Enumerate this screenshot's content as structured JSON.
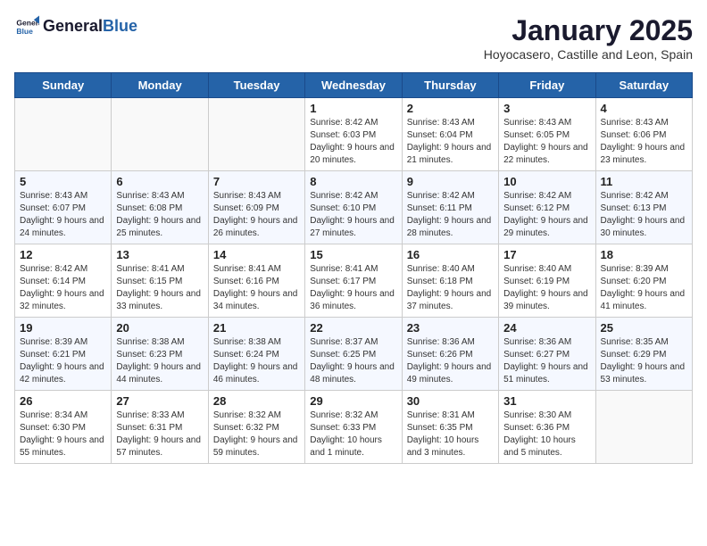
{
  "logo": {
    "line1": "General",
    "line2": "Blue"
  },
  "title": "January 2025",
  "subtitle": "Hoyocasero, Castille and Leon, Spain",
  "days_of_week": [
    "Sunday",
    "Monday",
    "Tuesday",
    "Wednesday",
    "Thursday",
    "Friday",
    "Saturday"
  ],
  "weeks": [
    [
      {
        "day": "",
        "info": ""
      },
      {
        "day": "",
        "info": ""
      },
      {
        "day": "",
        "info": ""
      },
      {
        "day": "1",
        "info": "Sunrise: 8:42 AM\nSunset: 6:03 PM\nDaylight: 9 hours and 20 minutes."
      },
      {
        "day": "2",
        "info": "Sunrise: 8:43 AM\nSunset: 6:04 PM\nDaylight: 9 hours and 21 minutes."
      },
      {
        "day": "3",
        "info": "Sunrise: 8:43 AM\nSunset: 6:05 PM\nDaylight: 9 hours and 22 minutes."
      },
      {
        "day": "4",
        "info": "Sunrise: 8:43 AM\nSunset: 6:06 PM\nDaylight: 9 hours and 23 minutes."
      }
    ],
    [
      {
        "day": "5",
        "info": "Sunrise: 8:43 AM\nSunset: 6:07 PM\nDaylight: 9 hours and 24 minutes."
      },
      {
        "day": "6",
        "info": "Sunrise: 8:43 AM\nSunset: 6:08 PM\nDaylight: 9 hours and 25 minutes."
      },
      {
        "day": "7",
        "info": "Sunrise: 8:43 AM\nSunset: 6:09 PM\nDaylight: 9 hours and 26 minutes."
      },
      {
        "day": "8",
        "info": "Sunrise: 8:42 AM\nSunset: 6:10 PM\nDaylight: 9 hours and 27 minutes."
      },
      {
        "day": "9",
        "info": "Sunrise: 8:42 AM\nSunset: 6:11 PM\nDaylight: 9 hours and 28 minutes."
      },
      {
        "day": "10",
        "info": "Sunrise: 8:42 AM\nSunset: 6:12 PM\nDaylight: 9 hours and 29 minutes."
      },
      {
        "day": "11",
        "info": "Sunrise: 8:42 AM\nSunset: 6:13 PM\nDaylight: 9 hours and 30 minutes."
      }
    ],
    [
      {
        "day": "12",
        "info": "Sunrise: 8:42 AM\nSunset: 6:14 PM\nDaylight: 9 hours and 32 minutes."
      },
      {
        "day": "13",
        "info": "Sunrise: 8:41 AM\nSunset: 6:15 PM\nDaylight: 9 hours and 33 minutes."
      },
      {
        "day": "14",
        "info": "Sunrise: 8:41 AM\nSunset: 6:16 PM\nDaylight: 9 hours and 34 minutes."
      },
      {
        "day": "15",
        "info": "Sunrise: 8:41 AM\nSunset: 6:17 PM\nDaylight: 9 hours and 36 minutes."
      },
      {
        "day": "16",
        "info": "Sunrise: 8:40 AM\nSunset: 6:18 PM\nDaylight: 9 hours and 37 minutes."
      },
      {
        "day": "17",
        "info": "Sunrise: 8:40 AM\nSunset: 6:19 PM\nDaylight: 9 hours and 39 minutes."
      },
      {
        "day": "18",
        "info": "Sunrise: 8:39 AM\nSunset: 6:20 PM\nDaylight: 9 hours and 41 minutes."
      }
    ],
    [
      {
        "day": "19",
        "info": "Sunrise: 8:39 AM\nSunset: 6:21 PM\nDaylight: 9 hours and 42 minutes."
      },
      {
        "day": "20",
        "info": "Sunrise: 8:38 AM\nSunset: 6:23 PM\nDaylight: 9 hours and 44 minutes."
      },
      {
        "day": "21",
        "info": "Sunrise: 8:38 AM\nSunset: 6:24 PM\nDaylight: 9 hours and 46 minutes."
      },
      {
        "day": "22",
        "info": "Sunrise: 8:37 AM\nSunset: 6:25 PM\nDaylight: 9 hours and 48 minutes."
      },
      {
        "day": "23",
        "info": "Sunrise: 8:36 AM\nSunset: 6:26 PM\nDaylight: 9 hours and 49 minutes."
      },
      {
        "day": "24",
        "info": "Sunrise: 8:36 AM\nSunset: 6:27 PM\nDaylight: 9 hours and 51 minutes."
      },
      {
        "day": "25",
        "info": "Sunrise: 8:35 AM\nSunset: 6:29 PM\nDaylight: 9 hours and 53 minutes."
      }
    ],
    [
      {
        "day": "26",
        "info": "Sunrise: 8:34 AM\nSunset: 6:30 PM\nDaylight: 9 hours and 55 minutes."
      },
      {
        "day": "27",
        "info": "Sunrise: 8:33 AM\nSunset: 6:31 PM\nDaylight: 9 hours and 57 minutes."
      },
      {
        "day": "28",
        "info": "Sunrise: 8:32 AM\nSunset: 6:32 PM\nDaylight: 9 hours and 59 minutes."
      },
      {
        "day": "29",
        "info": "Sunrise: 8:32 AM\nSunset: 6:33 PM\nDaylight: 10 hours and 1 minute."
      },
      {
        "day": "30",
        "info": "Sunrise: 8:31 AM\nSunset: 6:35 PM\nDaylight: 10 hours and 3 minutes."
      },
      {
        "day": "31",
        "info": "Sunrise: 8:30 AM\nSunset: 6:36 PM\nDaylight: 10 hours and 5 minutes."
      },
      {
        "day": "",
        "info": ""
      }
    ]
  ]
}
